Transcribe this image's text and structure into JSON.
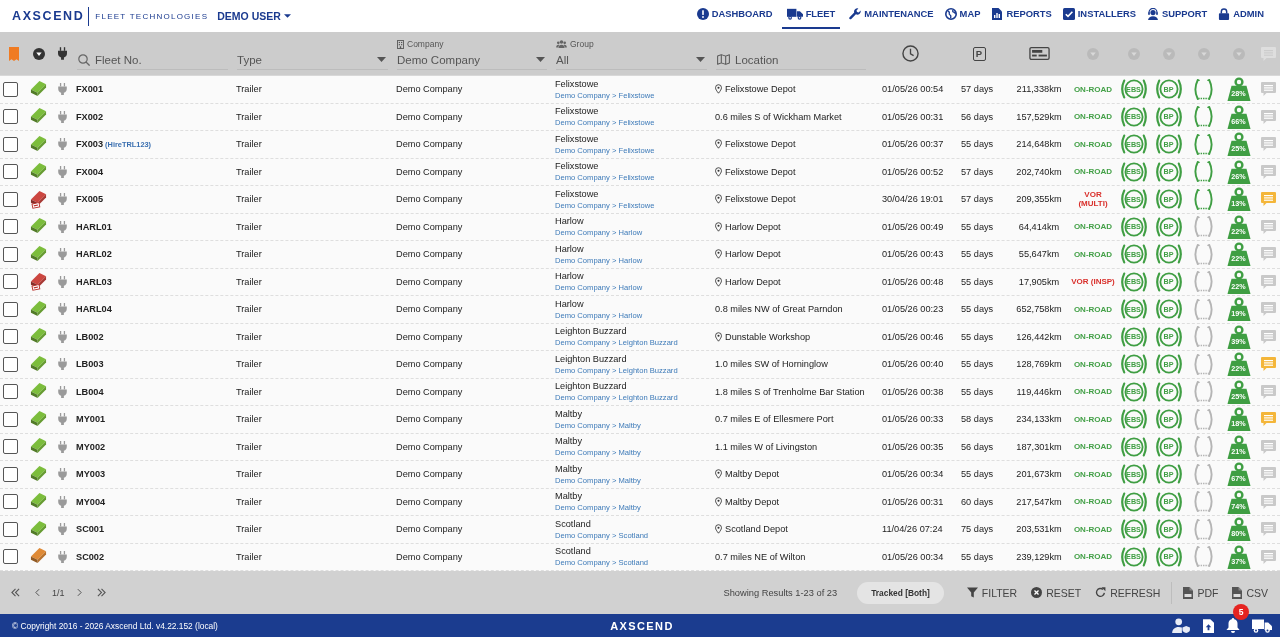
{
  "header": {
    "logo": "AXSCEND",
    "tagline": "FLEET TECHNOLOGIES",
    "user_menu": "DEMO USER",
    "nav": [
      {
        "label": "DASHBOARD",
        "selected": false
      },
      {
        "label": "FLEET",
        "selected": true
      },
      {
        "label": "MAINTENANCE",
        "selected": false
      },
      {
        "label": "MAP",
        "selected": false
      },
      {
        "label": "REPORTS",
        "selected": false
      },
      {
        "label": "INSTALLERS",
        "selected": false
      },
      {
        "label": "SUPPORT",
        "selected": false
      },
      {
        "label": "ADMIN",
        "selected": false
      }
    ]
  },
  "filters": {
    "fleet_no": {
      "placeholder": "Fleet No."
    },
    "type": {
      "placeholder": "Type"
    },
    "company": {
      "label": "Company",
      "value": "Demo Company"
    },
    "group": {
      "label": "Group",
      "value": "All"
    },
    "location": {
      "placeholder": "Location"
    },
    "parking_symbol": "P"
  },
  "table": {
    "rows": [
      {
        "checked": false,
        "trailer": {
          "color": "#7cbd3c",
          "vor_tag": false
        },
        "fleet_no": "FX001",
        "type": "Trailer",
        "company": "Demo Company",
        "group": "Felixstowe",
        "group_path": "Demo Company > Felixstowe",
        "location": "Felixstowe Depot",
        "at_site": true,
        "last_report": "01/05/26 00:54",
        "days": "57 days",
        "odometer": "211,338km",
        "status": {
          "kind": "on_road",
          "text": "ON-ROAD"
        },
        "systems": [
          "EBS",
          "BP"
        ],
        "tpms": true,
        "load": "28%",
        "has_notes": false
      },
      {
        "checked": false,
        "trailer": {
          "color": "#7cbd3c",
          "vor_tag": false
        },
        "fleet_no": "FX002",
        "type": "Trailer",
        "company": "Demo Company",
        "group": "Felixstowe",
        "group_path": "Demo Company > Felixstowe",
        "location": "0.6 miles S of Wickham Market",
        "at_site": false,
        "last_report": "01/05/26 00:31",
        "days": "56 days",
        "odometer": "157,529km",
        "status": {
          "kind": "on_road",
          "text": "ON-ROAD"
        },
        "systems": [
          "EBS",
          "BP"
        ],
        "tpms": true,
        "load": "66%",
        "has_notes": false
      },
      {
        "checked": false,
        "trailer": {
          "color": "#7cbd3c",
          "vor_tag": false
        },
        "fleet_no": "FX003",
        "hire_ref": "(HireTRL123)",
        "type": "Trailer",
        "company": "Demo Company",
        "group": "Felixstowe",
        "group_path": "Demo Company > Felixstowe",
        "location": "Felixstowe Depot",
        "at_site": true,
        "last_report": "01/05/26 00:37",
        "days": "55 days",
        "odometer": "214,648km",
        "status": {
          "kind": "on_road",
          "text": "ON-ROAD"
        },
        "systems": [
          "EBS",
          "BP"
        ],
        "tpms": true,
        "load": "25%",
        "has_notes": false
      },
      {
        "checked": false,
        "trailer": {
          "color": "#7cbd3c",
          "vor_tag": false
        },
        "fleet_no": "FX004",
        "type": "Trailer",
        "company": "Demo Company",
        "group": "Felixstowe",
        "group_path": "Demo Company > Felixstowe",
        "location": "Felixstowe Depot",
        "at_site": true,
        "last_report": "01/05/26 00:52",
        "days": "57 days",
        "odometer": "202,740km",
        "status": {
          "kind": "on_road",
          "text": "ON-ROAD"
        },
        "systems": [
          "EBS",
          "BP"
        ],
        "tpms": true,
        "load": "26%",
        "has_notes": false
      },
      {
        "checked": false,
        "trailer": {
          "color": "#cc4640",
          "vor_tag": true
        },
        "fleet_no": "FX005",
        "type": "Trailer",
        "company": "Demo Company",
        "group": "Felixstowe",
        "group_path": "Demo Company > Felixstowe",
        "location": "Felixstowe Depot",
        "at_site": true,
        "last_report": "30/04/26 19:01",
        "days": "57 days",
        "odometer": "209,355km",
        "status": {
          "kind": "vor",
          "text": "VOR (MULTI)"
        },
        "systems": [
          "EBS",
          "BP"
        ],
        "tpms": true,
        "load": "13%",
        "has_notes": true
      },
      {
        "checked": false,
        "trailer": {
          "color": "#7cbd3c",
          "vor_tag": false
        },
        "fleet_no": "HARL01",
        "type": "Trailer",
        "company": "Demo Company",
        "group": "Harlow",
        "group_path": "Demo Company > Harlow",
        "location": "Harlow Depot",
        "at_site": true,
        "last_report": "01/05/26 00:49",
        "days": "55 days",
        "odometer": "64,414km",
        "status": {
          "kind": "on_road",
          "text": "ON-ROAD"
        },
        "systems": [
          "EBS",
          "BP"
        ],
        "tpms": false,
        "load": "22%",
        "has_notes": false
      },
      {
        "checked": false,
        "trailer": {
          "color": "#7cbd3c",
          "vor_tag": false
        },
        "fleet_no": "HARL02",
        "type": "Trailer",
        "company": "Demo Company",
        "group": "Harlow",
        "group_path": "Demo Company > Harlow",
        "location": "Harlow Depot",
        "at_site": true,
        "last_report": "01/05/26 00:43",
        "days": "55 days",
        "odometer": "55,647km",
        "status": {
          "kind": "on_road",
          "text": "ON-ROAD"
        },
        "systems": [
          "EBS",
          "BP"
        ],
        "tpms": false,
        "load": "22%",
        "has_notes": false
      },
      {
        "checked": false,
        "trailer": {
          "color": "#cc4640",
          "vor_tag": true
        },
        "fleet_no": "HARL03",
        "type": "Trailer",
        "company": "Demo Company",
        "group": "Harlow",
        "group_path": "Demo Company > Harlow",
        "location": "Harlow Depot",
        "at_site": true,
        "last_report": "01/05/26 00:48",
        "days": "55 days",
        "odometer": "17,905km",
        "status": {
          "kind": "vor",
          "text": "VOR (INSP)"
        },
        "systems": [
          "EBS",
          "BP"
        ],
        "tpms": false,
        "load": "22%",
        "has_notes": false
      },
      {
        "checked": false,
        "trailer": {
          "color": "#7cbd3c",
          "vor_tag": false
        },
        "fleet_no": "HARL04",
        "type": "Trailer",
        "company": "Demo Company",
        "group": "Harlow",
        "group_path": "Demo Company > Harlow",
        "location": "0.8 miles NW of Great Parndon",
        "at_site": false,
        "last_report": "01/05/26 00:23",
        "days": "55 days",
        "odometer": "652,758km",
        "status": {
          "kind": "on_road",
          "text": "ON-ROAD"
        },
        "systems": [
          "EBS",
          "BP"
        ],
        "tpms": false,
        "load": "19%",
        "has_notes": false
      },
      {
        "checked": false,
        "trailer": {
          "color": "#7cbd3c",
          "vor_tag": false
        },
        "fleet_no": "LB002",
        "type": "Trailer",
        "company": "Demo Company",
        "group": "Leighton Buzzard",
        "group_path": "Demo Company > Leighton Buzzard",
        "location": "Dunstable Workshop",
        "at_site": true,
        "last_report": "01/05/26 00:46",
        "days": "55 days",
        "odometer": "126,442km",
        "status": {
          "kind": "on_road",
          "text": "ON-ROAD"
        },
        "systems": [
          "EBS",
          "BP"
        ],
        "tpms": false,
        "load": "39%",
        "has_notes": false
      },
      {
        "checked": false,
        "trailer": {
          "color": "#7cbd3c",
          "vor_tag": false
        },
        "fleet_no": "LB003",
        "type": "Trailer",
        "company": "Demo Company",
        "group": "Leighton Buzzard",
        "group_path": "Demo Company > Leighton Buzzard",
        "location": "1.0 miles SW of Horninglow",
        "at_site": false,
        "last_report": "01/05/26 00:40",
        "days": "55 days",
        "odometer": "128,769km",
        "status": {
          "kind": "on_road",
          "text": "ON-ROAD"
        },
        "systems": [
          "EBS",
          "BP"
        ],
        "tpms": false,
        "load": "22%",
        "has_notes": true
      },
      {
        "checked": false,
        "trailer": {
          "color": "#7cbd3c",
          "vor_tag": false
        },
        "fleet_no": "LB004",
        "type": "Trailer",
        "company": "Demo Company",
        "group": "Leighton Buzzard",
        "group_path": "Demo Company > Leighton Buzzard",
        "location": "1.8 miles S of Trenholme Bar Station",
        "at_site": false,
        "last_report": "01/05/26 00:38",
        "days": "55 days",
        "odometer": "119,446km",
        "status": {
          "kind": "on_road",
          "text": "ON-ROAD"
        },
        "systems": [
          "EBS",
          "BP"
        ],
        "tpms": false,
        "load": "25%",
        "has_notes": false
      },
      {
        "checked": false,
        "trailer": {
          "color": "#7cbd3c",
          "vor_tag": false
        },
        "fleet_no": "MY001",
        "type": "Trailer",
        "company": "Demo Company",
        "group": "Maltby",
        "group_path": "Demo Company > Maltby",
        "location": "0.7 miles E of Ellesmere Port",
        "at_site": false,
        "last_report": "01/05/26 00:33",
        "days": "58 days",
        "odometer": "234,133km",
        "status": {
          "kind": "on_road",
          "text": "ON-ROAD"
        },
        "systems": [
          "EBS",
          "BP"
        ],
        "tpms": false,
        "load": "18%",
        "has_notes": true
      },
      {
        "checked": false,
        "trailer": {
          "color": "#7cbd3c",
          "vor_tag": false
        },
        "fleet_no": "MY002",
        "type": "Trailer",
        "company": "Demo Company",
        "group": "Maltby",
        "group_path": "Demo Company > Maltby",
        "location": "1.1 miles W of Livingston",
        "at_site": false,
        "last_report": "01/05/26 00:35",
        "days": "56 days",
        "odometer": "187,301km",
        "status": {
          "kind": "on_road",
          "text": "ON-ROAD"
        },
        "systems": [
          "EBS",
          "BP"
        ],
        "tpms": false,
        "load": "21%",
        "has_notes": false
      },
      {
        "checked": false,
        "trailer": {
          "color": "#7cbd3c",
          "vor_tag": false
        },
        "fleet_no": "MY003",
        "type": "Trailer",
        "company": "Demo Company",
        "group": "Maltby",
        "group_path": "Demo Company > Maltby",
        "location": "Maltby Depot",
        "at_site": true,
        "last_report": "01/05/26 00:34",
        "days": "55 days",
        "odometer": "201,673km",
        "status": {
          "kind": "on_road",
          "text": "ON-ROAD"
        },
        "systems": [
          "EBS",
          "BP"
        ],
        "tpms": false,
        "load": "67%",
        "has_notes": false
      },
      {
        "checked": false,
        "trailer": {
          "color": "#7cbd3c",
          "vor_tag": false
        },
        "fleet_no": "MY004",
        "type": "Trailer",
        "company": "Demo Company",
        "group": "Maltby",
        "group_path": "Demo Company > Maltby",
        "location": "Maltby Depot",
        "at_site": true,
        "last_report": "01/05/26 00:31",
        "days": "60 days",
        "odometer": "217,547km",
        "status": {
          "kind": "on_road",
          "text": "ON-ROAD"
        },
        "systems": [
          "EBS",
          "BP"
        ],
        "tpms": false,
        "load": "74%",
        "has_notes": false
      },
      {
        "checked": false,
        "trailer": {
          "color": "#7cbd3c",
          "vor_tag": false
        },
        "fleet_no": "SC001",
        "type": "Trailer",
        "company": "Demo Company",
        "group": "Scotland",
        "group_path": "Demo Company > Scotland",
        "location": "Scotland Depot",
        "at_site": true,
        "last_report": "11/04/26 07:24",
        "days": "75 days",
        "odometer": "203,531km",
        "status": {
          "kind": "on_road",
          "text": "ON-ROAD"
        },
        "systems": [
          "EBS",
          "BP"
        ],
        "tpms": false,
        "load": "80%",
        "has_notes": false
      },
      {
        "checked": false,
        "trailer": {
          "color": "#df8a36",
          "vor_tag": false
        },
        "fleet_no": "SC002",
        "type": "Trailer",
        "company": "Demo Company",
        "group": "Scotland",
        "group_path": "Demo Company > Scotland",
        "location": "0.7 miles NE of Wilton",
        "at_site": false,
        "last_report": "01/05/26 00:34",
        "days": "55 days",
        "odometer": "239,129km",
        "status": {
          "kind": "on_road",
          "text": "ON-ROAD"
        },
        "systems": [
          "EBS",
          "BP"
        ],
        "tpms": false,
        "load": "37%",
        "has_notes": false
      }
    ]
  },
  "toolbar": {
    "page": "1/1",
    "results": "Showing Results 1-23 of 23",
    "tracked_filter": "Tracked [Both]",
    "actions": [
      {
        "label": "FILTER"
      },
      {
        "label": "RESET"
      },
      {
        "label": "REFRESH"
      },
      {
        "label": "PDF"
      },
      {
        "label": "CSV"
      }
    ]
  },
  "footer": {
    "copyright": "© Copyright 2016 - 2026 Axscend Ltd. v4.22.152 (local)",
    "logo": "AXSCEND",
    "notifications": "5"
  }
}
